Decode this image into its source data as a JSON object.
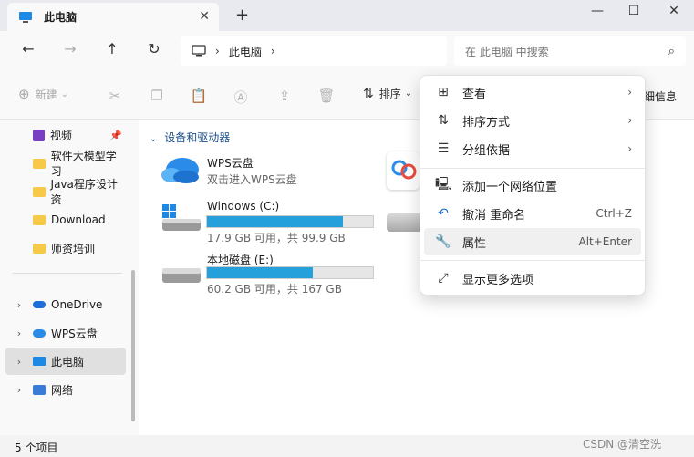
{
  "tab": {
    "title": "此电脑"
  },
  "address": {
    "crumb": "此电脑"
  },
  "search": {
    "placeholder": "在 此电脑 中搜索"
  },
  "toolbar": {
    "new_label": "新建",
    "sort_label": "排序",
    "details_label": "细信息"
  },
  "sidebar": {
    "items": [
      {
        "label": "视频"
      },
      {
        "label": "软件大模型学习"
      },
      {
        "label": "Java程序设计资"
      },
      {
        "label": "Download"
      },
      {
        "label": "师资培训"
      },
      {
        "label": "OneDrive"
      },
      {
        "label": "WPS云盘"
      },
      {
        "label": "此电脑"
      },
      {
        "label": "网络"
      }
    ]
  },
  "main": {
    "group_header": "设备和驱动器",
    "wps": {
      "name": "WPS云盘",
      "sub": "双击进入WPS云盘"
    },
    "drive_c": {
      "name": "Windows (C:)",
      "sub": "17.9 GB 可用，共 99.9 GB",
      "used_fraction": 0.82
    },
    "drive_e": {
      "name": "本地磁盘 (E:)",
      "sub": "60.2 GB 可用，共 167 GB",
      "used_fraction": 0.64
    }
  },
  "context_menu": {
    "items": [
      {
        "label": "查看"
      },
      {
        "label": "排序方式"
      },
      {
        "label": "分组依据"
      },
      {
        "label": "添加一个网络位置"
      },
      {
        "label": "撤消 重命名",
        "shortcut": "Ctrl+Z"
      },
      {
        "label": "属性",
        "shortcut": "Alt+Enter"
      },
      {
        "label": "显示更多选项"
      }
    ]
  },
  "status": {
    "count": "5 个项目"
  },
  "watermark": "CSDN @清空洗"
}
